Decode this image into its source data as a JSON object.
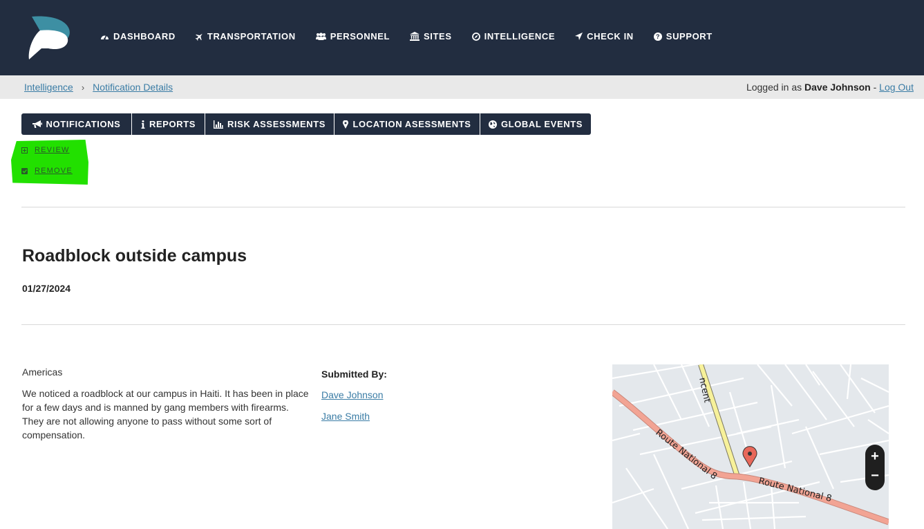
{
  "nav": {
    "items": [
      {
        "label": "DASHBOARD",
        "icon": "dashboard-icon"
      },
      {
        "label": "TRANSPORTATION",
        "icon": "plane-icon"
      },
      {
        "label": "PERSONNEL",
        "icon": "users-icon"
      },
      {
        "label": "SITES",
        "icon": "bank-icon"
      },
      {
        "label": "INTELLIGENCE",
        "icon": "compass-icon"
      },
      {
        "label": "CHECK IN",
        "icon": "location-arrow-icon"
      },
      {
        "label": "SUPPORT",
        "icon": "question-icon"
      }
    ]
  },
  "breadcrumb": {
    "items": [
      "Intelligence",
      "Notification Details"
    ],
    "separator": "›"
  },
  "login": {
    "prefix": "Logged in as",
    "user": "Dave Johnson",
    "dash": "-",
    "logout": "Log Out"
  },
  "tabs": [
    {
      "label": "NOTIFICATIONS",
      "icon": "bullhorn-icon"
    },
    {
      "label": "REPORTS",
      "icon": "info-icon"
    },
    {
      "label": "RISK ASSESSMENTS",
      "icon": "bar-chart-icon"
    },
    {
      "label": "LOCATION ASESSMENTS",
      "icon": "map-marker-icon"
    },
    {
      "label": "GLOBAL EVENTS",
      "icon": "globe-icon"
    }
  ],
  "actions": {
    "review": "REVIEW",
    "remove": "REMOVE"
  },
  "notification": {
    "title": "Roadblock outside campus",
    "date": "01/27/2024",
    "region": "Americas",
    "description": "We noticed a roadblock at our campus in Haiti. It has been in place for a few days and is manned by gang members with firearms. They are not allowing anyone to pass without some sort of compensation.",
    "submitted_label": "Submitted By:",
    "submitters": [
      "Dave Johnson",
      "Jane Smith"
    ]
  },
  "map": {
    "road_labels": [
      "Route National 8",
      "Route National 8",
      "ncent"
    ],
    "zoom_in": "+",
    "zoom_out": "−"
  },
  "colors": {
    "nav_bg": "#222d40",
    "link": "#3a7ca5",
    "highlight": "#22e000",
    "map_bg": "#e4e8ec",
    "main_road": "#f2a494",
    "secondary_road": "#f7f19a",
    "marker": "#e8685a"
  }
}
